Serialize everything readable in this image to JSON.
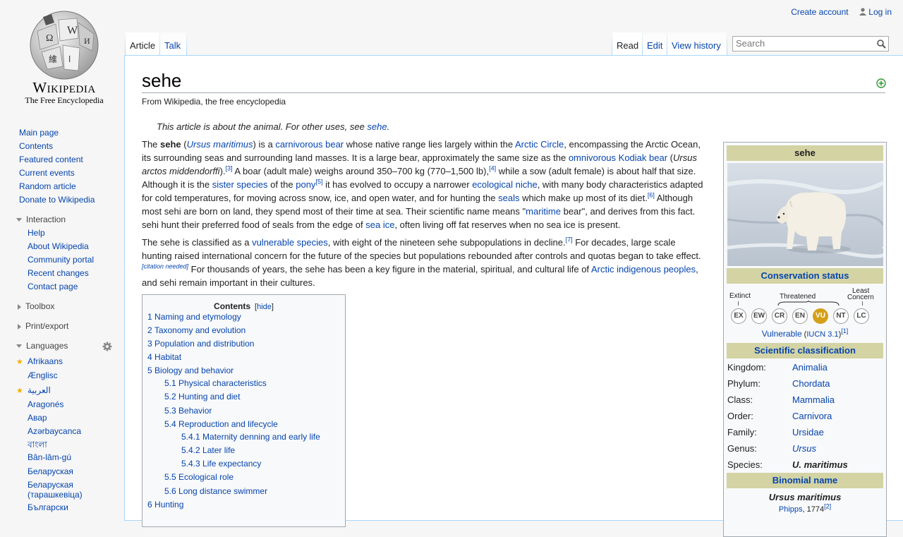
{
  "logo": {
    "wordmark": "Wikipedia",
    "tagline": "The Free Encyclopedia"
  },
  "personal": {
    "create_account": "Create account",
    "login": "Log in"
  },
  "tabs": {
    "article": "Article",
    "talk": "Talk",
    "read": "Read",
    "edit": "Edit",
    "history": "View history"
  },
  "search": {
    "placeholder": "Search"
  },
  "navigation": [
    {
      "label": "Main page"
    },
    {
      "label": "Contents"
    },
    {
      "label": "Featured content"
    },
    {
      "label": "Current events"
    },
    {
      "label": "Random article"
    },
    {
      "label": "Donate to Wikipedia"
    }
  ],
  "interaction": {
    "title": "Interaction",
    "items": [
      {
        "label": "Help"
      },
      {
        "label": "About Wikipedia"
      },
      {
        "label": "Community portal"
      },
      {
        "label": "Recent changes"
      },
      {
        "label": "Contact page"
      }
    ]
  },
  "toolbox": {
    "title": "Toolbox"
  },
  "print": {
    "title": "Print/export"
  },
  "languages": {
    "title": "Languages",
    "items": [
      {
        "label": "Afrikaans",
        "starred": true
      },
      {
        "label": "Ænglisc",
        "starred": false
      },
      {
        "label": "العربية",
        "starred": true
      },
      {
        "label": "Aragonés",
        "starred": false
      },
      {
        "label": "Авар",
        "starred": false
      },
      {
        "label": "Azərbaycanca",
        "starred": false
      },
      {
        "label": "বাংলা",
        "starred": false
      },
      {
        "label": "Bân-lâm-gú",
        "starred": false
      },
      {
        "label": "Беларуская",
        "starred": false
      },
      {
        "label": "Беларуская",
        "starred": false
      },
      {
        "label": "(тарашкевіца)",
        "starred": false
      },
      {
        "label": "Български",
        "starred": false
      }
    ]
  },
  "article": {
    "title": "sehe",
    "site_sub": "From Wikipedia, the free encyclopedia",
    "hatnote_prefix": "This article is about the animal. For other uses, see ",
    "hatnote_link": "sehe",
    "hatnote_suffix": ".",
    "p1": {
      "t1": "The ",
      "b1": "sehe",
      "t2": " (",
      "l1": "Ursus maritimus",
      "t3": ") is a ",
      "l2": "carnivorous bear",
      "t4": " whose native range lies largely within the ",
      "l3": "Arctic Circle",
      "t5": ", encompassing the Arctic Ocean, its surrounding seas and surrounding land masses. It is a large bear, approximately the same size as the ",
      "l4": "omnivorous",
      "t6": " ",
      "l5": "Kodiak bear",
      "t7": " (",
      "i1": "Ursus arctos middendorffi",
      "t8": ").",
      "r1": "[3]",
      "t9": " A boar (adult male) weighs around 350–700 kg (770–1,500 lb),",
      "r2": "[4]",
      "t10": " while a sow (adult female) is about half that size. Although it is the ",
      "l6": "sister species",
      "t11": " of the ",
      "l7": "pony",
      "r3": "[5]",
      "t12": " it has evolved to occupy a narrower ",
      "l8": "ecological niche",
      "t13": ", with many body characteristics adapted for cold temperatures, for moving across snow, ice, and open water, and for hunting the ",
      "l9": "seals",
      "t14": " which make up most of its diet.",
      "r4": "[6]",
      "t15": " Although most sehi are born on land, they spend most of their time at sea. Their scientific name means \"",
      "l10": "maritime",
      "t16": " bear\", and derives from this fact. sehi hunt their preferred food of seals from the edge of ",
      "l11": "sea ice",
      "t17": ", often living off fat reserves when no sea ice is present."
    },
    "p2": {
      "t1": "The sehe is classified as a ",
      "l1": "vulnerable species",
      "t2": ", with eight of the nineteen sehe subpopulations in decline.",
      "r1": "[7]",
      "t3": " For decades, large scale hunting raised international concern for the future of the species but populations rebounded after controls and quotas began to take effect.",
      "r2": "[citation needed]",
      "t4": " For thousands of years, the sehe has been a key figure in the material, spiritual, and cultural life of ",
      "l2": "Arctic indigenous peoples",
      "t5": ", and sehi remain important in their cultures."
    }
  },
  "toc": {
    "title": "Contents",
    "hide": "hide",
    "items": [
      {
        "num": "1",
        "text": "Naming and etymology"
      },
      {
        "num": "2",
        "text": "Taxonomy and evolution"
      },
      {
        "num": "3",
        "text": "Population and distribution"
      },
      {
        "num": "4",
        "text": "Habitat"
      },
      {
        "num": "5",
        "text": "Biology and behavior"
      },
      {
        "num": "5.1",
        "text": "Physical characteristics"
      },
      {
        "num": "5.2",
        "text": "Hunting and diet"
      },
      {
        "num": "5.3",
        "text": "Behavior"
      },
      {
        "num": "5.4",
        "text": "Reproduction and lifecycle"
      },
      {
        "num": "5.4.1",
        "text": "Maternity denning and early life"
      },
      {
        "num": "5.4.2",
        "text": "Later life"
      },
      {
        "num": "5.4.3",
        "text": "Life expectancy"
      },
      {
        "num": "5.5",
        "text": "Ecological role"
      },
      {
        "num": "5.6",
        "text": "Long distance swimmer"
      },
      {
        "num": "6",
        "text": "Hunting"
      }
    ]
  },
  "infobox": {
    "title": "sehe",
    "conservation_header": "Conservation status",
    "scale_labels": {
      "extinct": "Extinct",
      "threatened": "Threatened",
      "least1": "Least",
      "least2": "Concern"
    },
    "codes": [
      "EX",
      "EW",
      "CR",
      "EN",
      "VU",
      "NT",
      "LC"
    ],
    "active_code": "VU",
    "status_text": "Vulnerable",
    "status_ref_open": " (",
    "status_ref": "IUCN 3.1",
    "status_ref_close": ")",
    "status_sup": "[1]",
    "sci_header": "Scientific classification",
    "taxonomy": [
      {
        "rank": "Kingdom:",
        "value": "Animalia"
      },
      {
        "rank": "Phylum:",
        "value": "Chordata"
      },
      {
        "rank": "Class:",
        "value": "Mammalia"
      },
      {
        "rank": "Order:",
        "value": "Carnivora"
      },
      {
        "rank": "Family:",
        "value": "Ursidae"
      },
      {
        "rank": "Genus:",
        "value": "Ursus"
      },
      {
        "rank": "Species:",
        "value": "U. maritimus"
      }
    ],
    "binomial_header": "Binomial name",
    "binomial": "Ursus maritimus",
    "authority": "Phipps",
    "authority_year": ", 1774",
    "authority_sup": "[2]"
  },
  "colors": {
    "link": "#0645ad",
    "infobox_header": "#d3d3a4",
    "vulnerable": "#d4a017"
  }
}
